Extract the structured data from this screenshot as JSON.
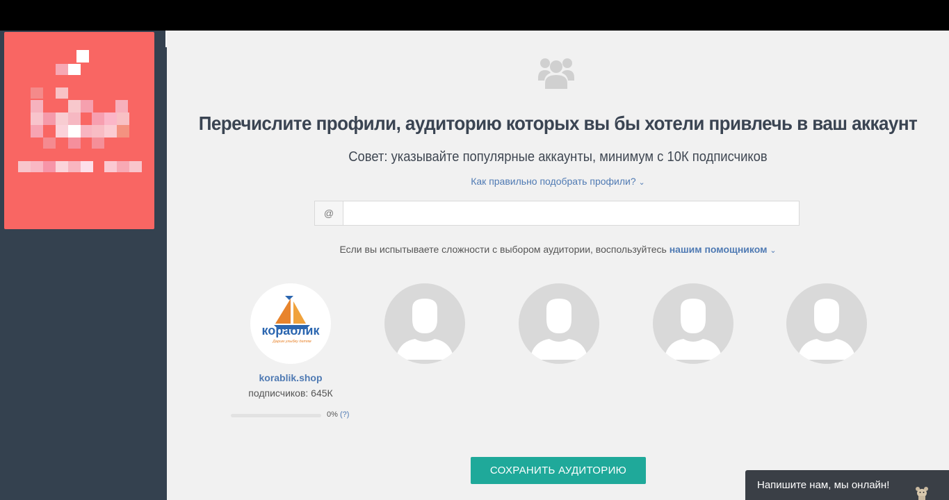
{
  "main": {
    "title": "Перечислите профили, аудиторию которых вы бы хотели привлечь в ваш аккаунт",
    "subtitle": "Совет: указывайте популярные аккаунты, минимум с 10К подписчиков",
    "howto_link": "Как правильно подобрать профили?",
    "chevron": "⌄"
  },
  "search": {
    "prefix": "@",
    "value": ""
  },
  "helper": {
    "text": "Если вы испытываете сложности с выбором аудитории, воспользуйтесь",
    "link": "нашим помощником"
  },
  "profiles": [
    {
      "avatar_type": "logo",
      "logo_text": "кораблик",
      "logo_tagline": "Дарим улыбку детям",
      "name": "korablik.shop",
      "subscribers": "подписчиков: 645К",
      "progress": 0,
      "progress_label": "0%",
      "help": "(?)"
    },
    {
      "avatar_type": "placeholder"
    },
    {
      "avatar_type": "placeholder"
    },
    {
      "avatar_type": "placeholder"
    },
    {
      "avatar_type": "placeholder"
    }
  ],
  "actions": {
    "save_label": "СОХРАНИТЬ АУДИТОРИЮ"
  },
  "chat": {
    "label": "Напишите нам, мы онлайн!"
  },
  "icons": {
    "header": "users-group-icon",
    "chat": "mascot-icon"
  },
  "colors": {
    "accent": "#1fa99a",
    "link": "#4f7ab3",
    "sidebar": "#34414f",
    "card": "#f96663",
    "background": "#f1f1f1"
  }
}
